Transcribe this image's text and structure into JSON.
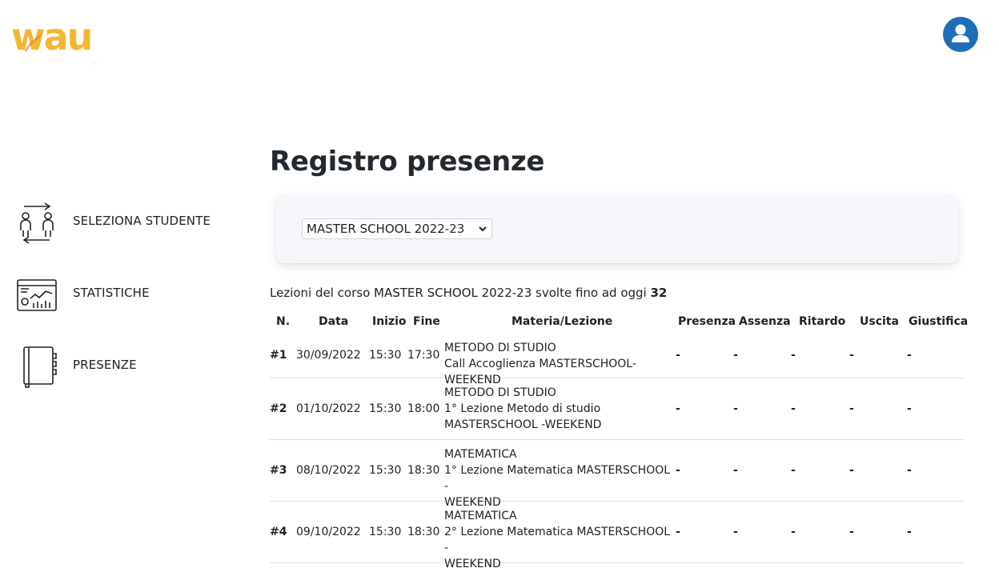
{
  "brand": {
    "logo_text": "wau",
    "logo_color": "#f2b731",
    "accent": "#1f6fb8"
  },
  "header": {
    "avatar_icon": "user-icon"
  },
  "sidebar": {
    "items": [
      {
        "label": "SELEZIONA STUDENTE",
        "icon": "students-swap-icon"
      },
      {
        "label": "STATISTICHE",
        "icon": "statistics-dashboard-icon"
      },
      {
        "label": "PRESENZE",
        "icon": "notebook-icon"
      }
    ]
  },
  "page": {
    "title": "Registro presenze",
    "course_select": {
      "selected": "MASTER SCHOOL 2022-23"
    },
    "summary_prefix": "Lezioni del corso MASTER SCHOOL 2022-23 svolte fino ad oggi",
    "summary_count": "32"
  },
  "table": {
    "headers": [
      "N.",
      "Data",
      "Inizio",
      "Fine",
      "Materia/Lezione",
      "Presenza",
      "Assenza",
      "Ritardo",
      "Uscita",
      "Giustifica"
    ],
    "rows": [
      {
        "n": "#1",
        "date": "30/09/2022",
        "start": "15:30",
        "end": "17:30",
        "subject": "METODO DI STUDIO",
        "lesson_lines": [
          "Call Accoglienza MASTERSCHOOL-WEEKEND"
        ],
        "presenza": "-",
        "assenza": "-",
        "ritardo": "-",
        "uscita": "-",
        "giustifica": "-"
      },
      {
        "n": "#2",
        "date": "01/10/2022",
        "start": "15:30",
        "end": "18:00",
        "subject": "METODO DI STUDIO",
        "lesson_lines": [
          "1° Lezione Metodo di studio",
          "MASTERSCHOOL -WEEKEND"
        ],
        "presenza": "-",
        "assenza": "-",
        "ritardo": "-",
        "uscita": "-",
        "giustifica": "-"
      },
      {
        "n": "#3",
        "date": "08/10/2022",
        "start": "15:30",
        "end": "18:30",
        "subject": "MATEMATICA",
        "lesson_lines": [
          "1° Lezione Matematica MASTERSCHOOL -",
          "WEEKEND"
        ],
        "presenza": "-",
        "assenza": "-",
        "ritardo": "-",
        "uscita": "-",
        "giustifica": "-"
      },
      {
        "n": "#4",
        "date": "09/10/2022",
        "start": "15:30",
        "end": "18:30",
        "subject": "MATEMATICA",
        "lesson_lines": [
          "2° Lezione Matematica MASTERSCHOOL -",
          "WEEKEND"
        ],
        "presenza": "-",
        "assenza": "-",
        "ritardo": "-",
        "uscita": "-",
        "giustifica": "-"
      }
    ]
  }
}
